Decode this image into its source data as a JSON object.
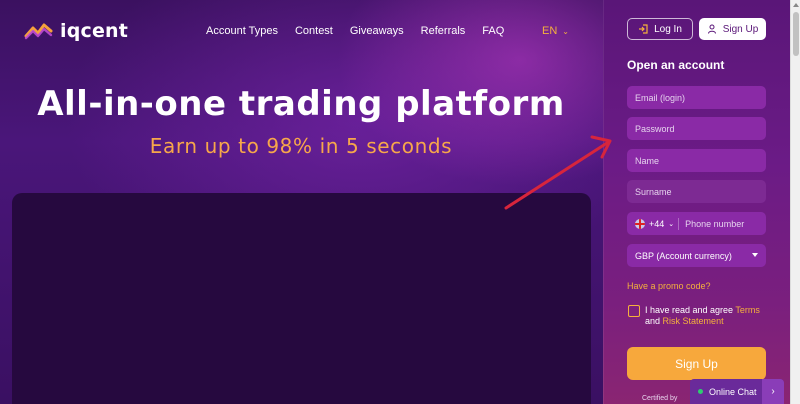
{
  "header": {
    "logo_text": "iqcent",
    "nav": [
      "Account Types",
      "Contest",
      "Giveaways",
      "Referrals",
      "FAQ"
    ],
    "language": "EN"
  },
  "hero": {
    "title": "All-in-one trading platform",
    "subtitle": "Earn up to 98% in 5 seconds"
  },
  "auth": {
    "login_label": "Log In",
    "signup_label": "Sign Up"
  },
  "form": {
    "title": "Open an account",
    "email_placeholder": "Email (login)",
    "password_placeholder": "Password",
    "name_placeholder": "Name",
    "surname_placeholder": "Surname",
    "phone_prefix": "+44",
    "phone_placeholder": "Phone number",
    "currency_value": "GBP (Account currency)",
    "promo_label": "Have a promo code?",
    "agree_text": "I have read and agree",
    "terms_label": "Terms",
    "and_text": "and",
    "risk_label": "Risk Statement",
    "submit_label": "Sign Up",
    "certified_text": "Certified by"
  },
  "chat": {
    "label": "Online Chat"
  },
  "colors": {
    "accent": "#f7a83c",
    "panel": "#6b1b86",
    "background": "#3a1160",
    "arrow": "#d8253c"
  }
}
